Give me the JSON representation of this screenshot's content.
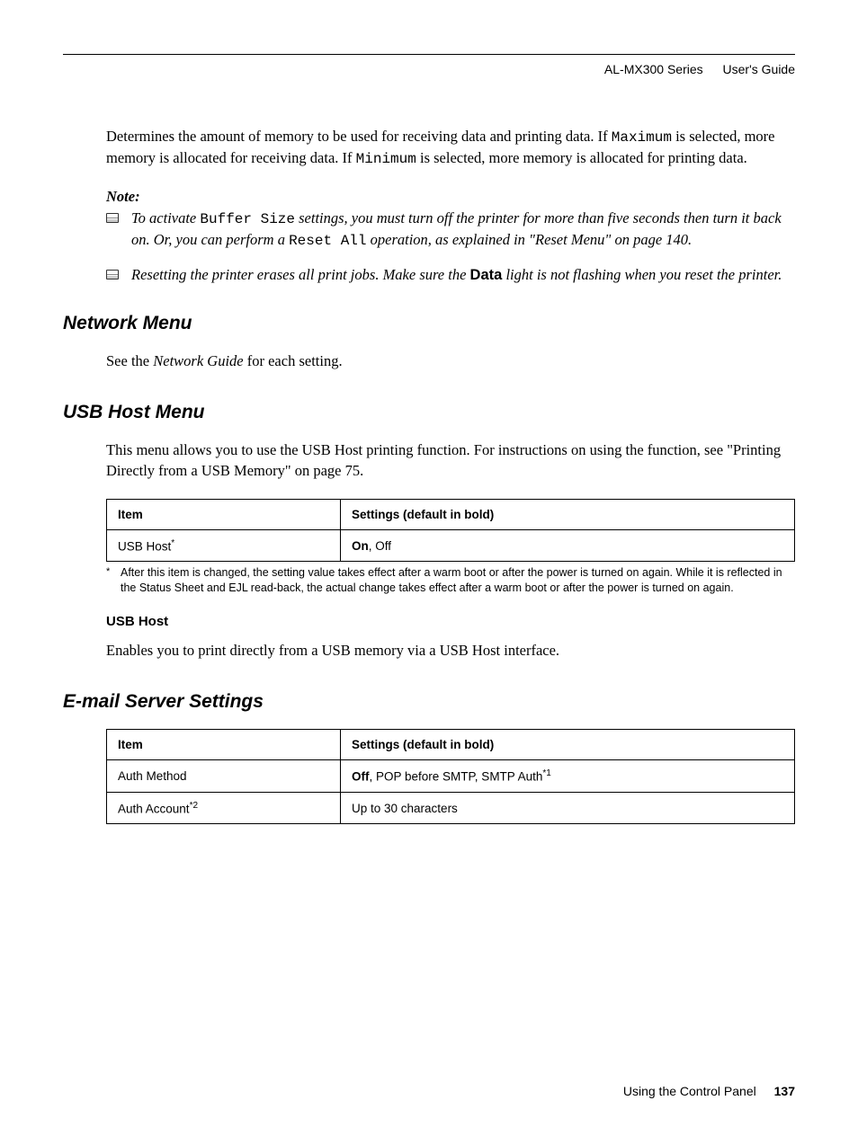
{
  "header": {
    "series": "AL-MX300 Series",
    "guide": "User's Guide"
  },
  "intro": {
    "p1a": "Determines the amount of memory to be used for receiving data and printing data. If ",
    "p1m1": "Maximum",
    "p1b": " is selected, more memory is allocated for receiving data. If ",
    "p1m2": "Minimum",
    "p1c": " is selected, more memory is allocated for printing data."
  },
  "note": {
    "label": "Note:",
    "items": [
      {
        "a": "To activate ",
        "m1": "Buffer Size",
        "b": " settings, you must turn off the printer for more than five seconds then turn it back on. Or, you can perform a ",
        "m2": "Reset All",
        "c": " operation, as explained in \"Reset Menu\" on page 140."
      },
      {
        "a": "Resetting the printer erases all print jobs. Make sure the ",
        "data": "Data",
        "b": " light is not flashing when you reset the printer."
      }
    ]
  },
  "sections": {
    "network": {
      "title": "Network Menu",
      "text_a": "See the ",
      "text_i": "Network Guide",
      "text_b": " for each setting."
    },
    "usbhost": {
      "title": "USB Host Menu",
      "intro": "This menu allows you to use the USB Host printing function. For instructions on using the function, see \"Printing Directly from a USB Memory\" on page 75.",
      "table": {
        "h_item": "Item",
        "h_settings": "Settings (default in bold)",
        "r1_item": "USB Host",
        "r1_sup": "*",
        "r1_default": "On",
        "r1_rest": ", Off"
      },
      "footnote": {
        "marker": "*",
        "text": "After this item is changed, the setting value takes effect after a warm boot or after the power is turned on again. While it is reflected in the Status Sheet and EJL read-back, the actual change takes effect after a warm boot or after the power is turned on again."
      },
      "sub_h": "USB Host",
      "sub_text": "Enables you to print directly from a USB memory via a USB Host interface."
    },
    "email": {
      "title": "E-mail Server Settings",
      "table": {
        "h_item": "Item",
        "h_settings": "Settings (default in bold)",
        "r1_item": "Auth Method",
        "r1_default": "Off",
        "r1_rest": ", POP before SMTP, SMTP Auth",
        "r1_sup": "*1",
        "r2_item": "Auth Account",
        "r2_sup": "*2",
        "r2_val": "Up to 30 characters"
      }
    }
  },
  "footer": {
    "section": "Using the Control Panel",
    "page": "137"
  }
}
